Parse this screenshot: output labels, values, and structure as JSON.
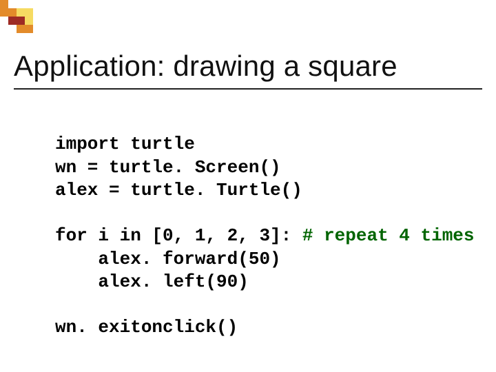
{
  "title": "Application: drawing a square",
  "code": {
    "0": "import turtle",
    "1": "wn = turtle. Screen()",
    "2": "alex = turtle. Turtle()",
    "3": "",
    "4": {
      "text": "for i in [0, 1, 2, 3]:",
      "comment": "# repeat 4 times"
    },
    "5": "alex. forward(50)",
    "6": "alex. left(90)",
    "7": "",
    "8": "wn. exitonclick()"
  },
  "colors": {
    "comment": "#006400",
    "accent_orange": "#e38b2a",
    "accent_red": "#9e2b24",
    "accent_yellow": "#f6db62"
  }
}
